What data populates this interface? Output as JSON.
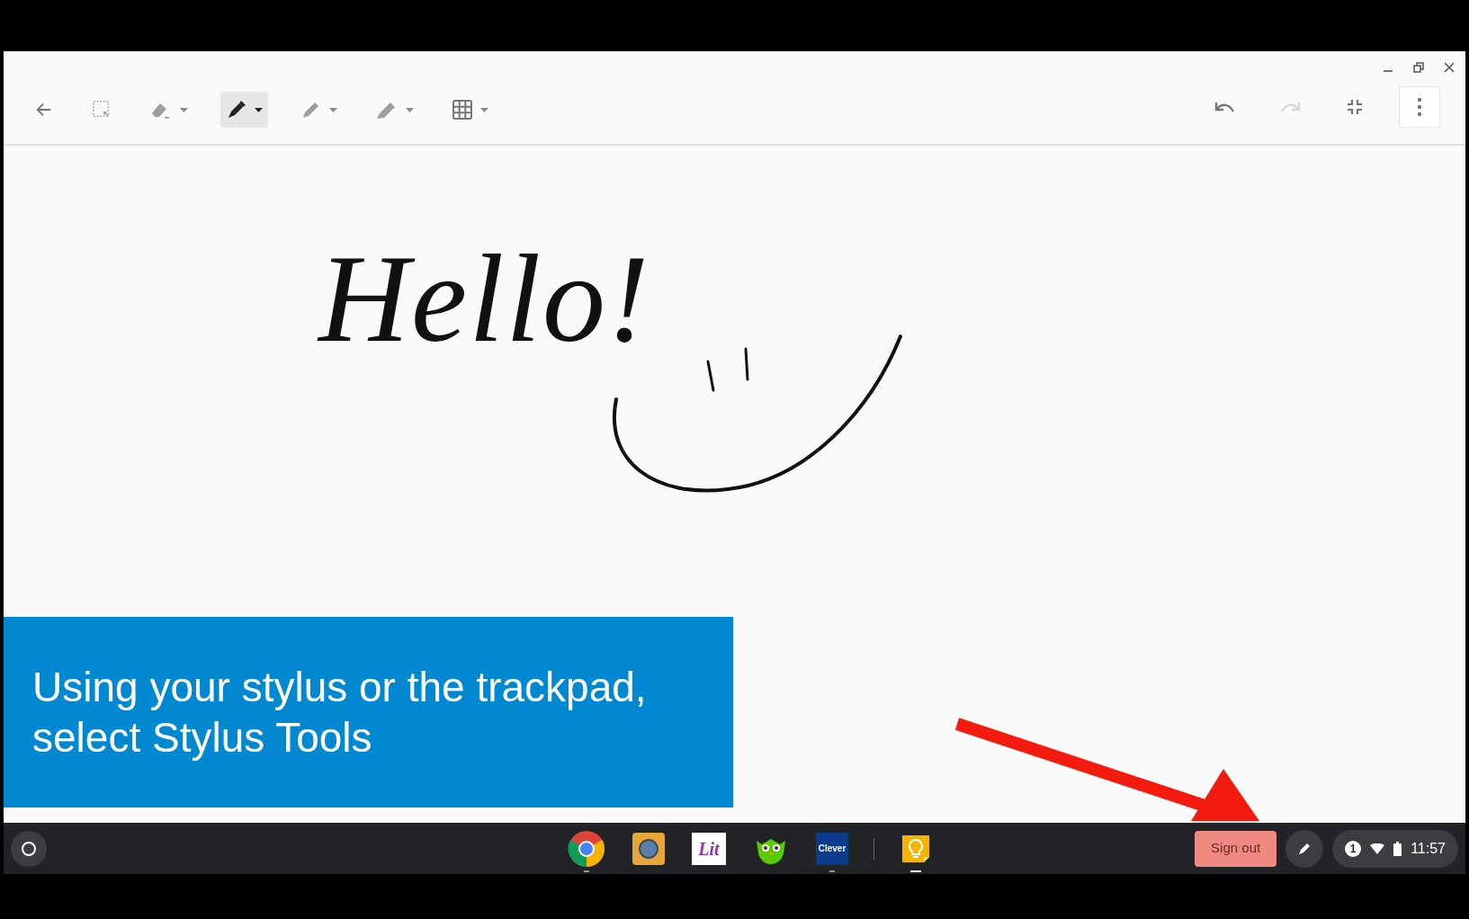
{
  "toolbar": {
    "tools": [
      {
        "kind": "back",
        "dropdown": false,
        "selected": false
      },
      {
        "kind": "select",
        "dropdown": false,
        "selected": false
      },
      {
        "kind": "eraser",
        "dropdown": true,
        "selected": false
      },
      {
        "kind": "pen",
        "dropdown": true,
        "selected": true
      },
      {
        "kind": "pencil",
        "dropdown": true,
        "selected": false
      },
      {
        "kind": "highlighter",
        "dropdown": true,
        "selected": false
      },
      {
        "kind": "grid",
        "dropdown": true,
        "selected": false
      }
    ],
    "actions": [
      {
        "kind": "undo",
        "disabled": false
      },
      {
        "kind": "redo",
        "disabled": true
      },
      {
        "kind": "exit-fullscreen",
        "disabled": false
      },
      {
        "kind": "more",
        "disabled": false
      }
    ]
  },
  "canvas": {
    "ink_text": "Hello!"
  },
  "caption": "Using your stylus or the trackpad, select Stylus Tools",
  "shelf": {
    "apps": [
      {
        "kind": "chrome",
        "running": true,
        "active": false
      },
      {
        "kind": "robot",
        "running": false,
        "active": false
      },
      {
        "kind": "lit",
        "label": "Lit",
        "running": false,
        "active": false
      },
      {
        "kind": "owl",
        "running": false,
        "active": false
      },
      {
        "kind": "clever",
        "label": "Clever",
        "running": true,
        "active": false
      },
      {
        "kind": "separator"
      },
      {
        "kind": "keep",
        "running": true,
        "active": true
      }
    ],
    "sign_out": "Sign out",
    "notification_count": "1",
    "time": "11:57"
  }
}
